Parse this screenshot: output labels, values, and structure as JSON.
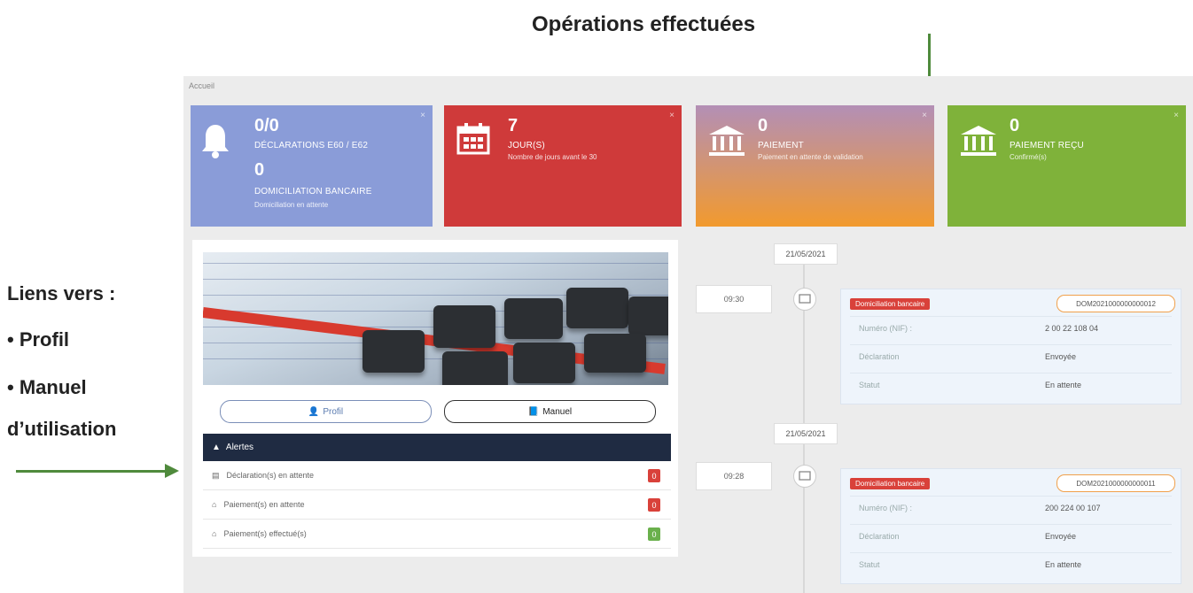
{
  "annotations": {
    "top_title": "Opérations effectuées",
    "left_lines": [
      "Liens vers :",
      "• Profil",
      "•   Manuel",
      "d’utilisation"
    ]
  },
  "app": {
    "breadcrumb": "Accueil",
    "tiles": [
      {
        "value1": "0/0",
        "label1": "DÉCLARATIONS E60 / E62",
        "value2": "0",
        "label2": "DOMICILIATION BANCAIRE",
        "sub": "Domiciliation en attente",
        "color": "#8a9cd8",
        "icon": "bell-icon"
      },
      {
        "value1": "7",
        "label1": "JOUR(S)",
        "sub": "Nombre de jours avant le 30",
        "color": "#cf3a3a",
        "icon": "calendar-icon"
      },
      {
        "value1": "0",
        "label1": "PAIEMENT",
        "sub": "Paiement en attente de validation",
        "color": "#f29a2e",
        "icon": "bank-icon"
      },
      {
        "value1": "0",
        "label1": "PAIEMENT REÇU",
        "sub": "Confirmé(s)",
        "color": "#7fb23a",
        "icon": "bank-icon"
      }
    ],
    "links": {
      "profil": "Profil",
      "manuel": "Manuel"
    },
    "alerts": {
      "header": "Alertes",
      "rows": [
        {
          "label": "Déclaration(s) en attente",
          "count": "0",
          "color": "#d9413a"
        },
        {
          "label": "Paiement(s) en attente",
          "count": "0",
          "color": "#d9413a"
        },
        {
          "label": "Paiement(s) effectué(s)",
          "count": "0",
          "color": "#6ab04c"
        }
      ]
    },
    "timeline": [
      {
        "date": "21/05/2021",
        "time": "09:30",
        "tag": "Domiciliation bancaire",
        "ref": "DOM2021000000000012",
        "rows": [
          {
            "k": "Numéro (NIF) :",
            "v": "2 00 22 108 04"
          },
          {
            "k": "Déclaration",
            "v": "Envoyée"
          },
          {
            "k": "Statut",
            "v": "En attente"
          }
        ]
      },
      {
        "date": "21/05/2021",
        "time": "09:28",
        "tag": "Domiciliation bancaire",
        "ref": "DOM2021000000000011",
        "rows": [
          {
            "k": "Numéro (NIF) :",
            "v": "200 224 00 107"
          },
          {
            "k": "Déclaration",
            "v": "Envoyée"
          },
          {
            "k": "Statut",
            "v": "En attente"
          }
        ]
      }
    ]
  }
}
